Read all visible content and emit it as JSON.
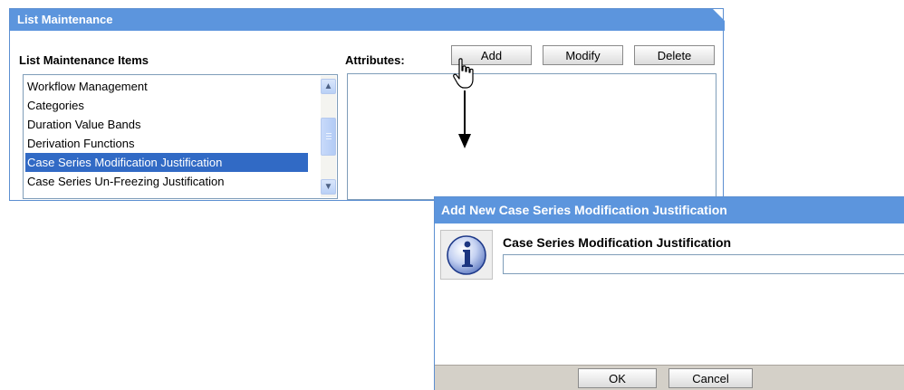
{
  "panel": {
    "title": "List Maintenance",
    "items_label": "List Maintenance Items",
    "attributes_label": "Attributes:",
    "items": [
      {
        "label": "Workflow Management",
        "selected": false
      },
      {
        "label": "Categories",
        "selected": false
      },
      {
        "label": "Duration Value Bands",
        "selected": false
      },
      {
        "label": "Derivation Functions",
        "selected": false
      },
      {
        "label": "Case Series Modification Justification",
        "selected": true
      },
      {
        "label": "Case Series Un-Freezing Justification",
        "selected": false
      }
    ],
    "buttons": {
      "add": "Add",
      "modify": "Modify",
      "delete": "Delete"
    }
  },
  "dialog": {
    "title": "Add New Case Series Modification Justification",
    "field_label": "Case Series Modification Justification",
    "field_value": "",
    "ok": "OK",
    "cancel": "Cancel",
    "icon": "info-icon"
  },
  "colors": {
    "header_blue": "#5c95dd",
    "selection_blue": "#316ac5",
    "footer_gray": "#d4d0c8"
  }
}
